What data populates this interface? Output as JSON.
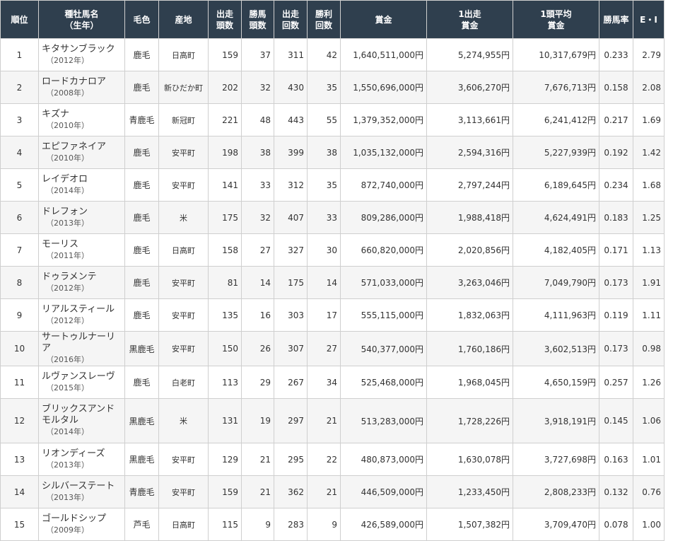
{
  "headers": {
    "rank": "順位",
    "name": "種牡馬名\n（生年）",
    "color": "毛色",
    "origin": "産地",
    "starters": "出走\n頭数",
    "winners": "勝馬\n頭数",
    "starts": "出走\n回数",
    "wins": "勝利\n回数",
    "earnings": "賞金",
    "per_start": "1出走\n賞金",
    "per_head": "1頭平均\n賞金",
    "win_rate": "勝馬率",
    "ei": "E・I"
  },
  "rows": [
    {
      "rank": "1",
      "name": "キタサンブラック",
      "year": "（2012年）",
      "color": "鹿毛",
      "origin": "日高町",
      "starters": "159",
      "winners": "37",
      "starts": "311",
      "wins": "42",
      "earnings": "1,640,511,000円",
      "per_start": "5,274,955円",
      "per_head": "10,317,679円",
      "win_rate": "0.233",
      "ei": "2.79"
    },
    {
      "rank": "2",
      "name": "ロードカナロア",
      "year": "（2008年）",
      "color": "鹿毛",
      "origin": "新ひだか町",
      "starters": "202",
      "winners": "32",
      "starts": "430",
      "wins": "35",
      "earnings": "1,550,696,000円",
      "per_start": "3,606,270円",
      "per_head": "7,676,713円",
      "win_rate": "0.158",
      "ei": "2.08"
    },
    {
      "rank": "3",
      "name": "キズナ",
      "year": "（2010年）",
      "color": "青鹿毛",
      "origin": "新冠町",
      "starters": "221",
      "winners": "48",
      "starts": "443",
      "wins": "55",
      "earnings": "1,379,352,000円",
      "per_start": "3,113,661円",
      "per_head": "6,241,412円",
      "win_rate": "0.217",
      "ei": "1.69"
    },
    {
      "rank": "4",
      "name": "エピファネイア",
      "year": "（2010年）",
      "color": "鹿毛",
      "origin": "安平町",
      "starters": "198",
      "winners": "38",
      "starts": "399",
      "wins": "38",
      "earnings": "1,035,132,000円",
      "per_start": "2,594,316円",
      "per_head": "5,227,939円",
      "win_rate": "0.192",
      "ei": "1.42"
    },
    {
      "rank": "5",
      "name": "レイデオロ",
      "year": "（2014年）",
      "color": "鹿毛",
      "origin": "安平町",
      "starters": "141",
      "winners": "33",
      "starts": "312",
      "wins": "35",
      "earnings": "872,740,000円",
      "per_start": "2,797,244円",
      "per_head": "6,189,645円",
      "win_rate": "0.234",
      "ei": "1.68"
    },
    {
      "rank": "6",
      "name": "ドレフォン",
      "year": "（2013年）",
      "color": "鹿毛",
      "origin": "米",
      "starters": "175",
      "winners": "32",
      "starts": "407",
      "wins": "33",
      "earnings": "809,286,000円",
      "per_start": "1,988,418円",
      "per_head": "4,624,491円",
      "win_rate": "0.183",
      "ei": "1.25"
    },
    {
      "rank": "7",
      "name": "モーリス",
      "year": "（2011年）",
      "color": "鹿毛",
      "origin": "日高町",
      "starters": "158",
      "winners": "27",
      "starts": "327",
      "wins": "30",
      "earnings": "660,820,000円",
      "per_start": "2,020,856円",
      "per_head": "4,182,405円",
      "win_rate": "0.171",
      "ei": "1.13"
    },
    {
      "rank": "8",
      "name": "ドゥラメンテ",
      "year": "（2012年）",
      "color": "鹿毛",
      "origin": "安平町",
      "starters": "81",
      "winners": "14",
      "starts": "175",
      "wins": "14",
      "earnings": "571,033,000円",
      "per_start": "3,263,046円",
      "per_head": "7,049,790円",
      "win_rate": "0.173",
      "ei": "1.91"
    },
    {
      "rank": "9",
      "name": "リアルスティール",
      "year": "（2012年）",
      "color": "鹿毛",
      "origin": "安平町",
      "starters": "135",
      "winners": "16",
      "starts": "303",
      "wins": "17",
      "earnings": "555,115,000円",
      "per_start": "1,832,063円",
      "per_head": "4,111,963円",
      "win_rate": "0.119",
      "ei": "1.11"
    },
    {
      "rank": "10",
      "name": "サートゥルナーリア",
      "year": "（2016年）",
      "color": "黒鹿毛",
      "origin": "安平町",
      "starters": "150",
      "winners": "26",
      "starts": "307",
      "wins": "27",
      "earnings": "540,377,000円",
      "per_start": "1,760,186円",
      "per_head": "3,602,513円",
      "win_rate": "0.173",
      "ei": "0.98"
    },
    {
      "rank": "11",
      "name": "ルヴァンスレーヴ",
      "year": "（2015年）",
      "color": "鹿毛",
      "origin": "白老町",
      "starters": "113",
      "winners": "29",
      "starts": "267",
      "wins": "34",
      "earnings": "525,468,000円",
      "per_start": "1,968,045円",
      "per_head": "4,650,159円",
      "win_rate": "0.257",
      "ei": "1.26"
    },
    {
      "rank": "12",
      "name": "ブリックスアンドモルタル",
      "year": "（2014年）",
      "color": "黒鹿毛",
      "origin": "米",
      "starters": "131",
      "winners": "19",
      "starts": "297",
      "wins": "21",
      "earnings": "513,283,000円",
      "per_start": "1,728,226円",
      "per_head": "3,918,191円",
      "win_rate": "0.145",
      "ei": "1.06"
    },
    {
      "rank": "13",
      "name": "リオンディーズ",
      "year": "（2013年）",
      "color": "黒鹿毛",
      "origin": "安平町",
      "starters": "129",
      "winners": "21",
      "starts": "295",
      "wins": "22",
      "earnings": "480,873,000円",
      "per_start": "1,630,078円",
      "per_head": "3,727,698円",
      "win_rate": "0.163",
      "ei": "1.01"
    },
    {
      "rank": "14",
      "name": "シルバーステート",
      "year": "（2013年）",
      "color": "青鹿毛",
      "origin": "安平町",
      "starters": "159",
      "winners": "21",
      "starts": "362",
      "wins": "21",
      "earnings": "446,509,000円",
      "per_start": "1,233,450円",
      "per_head": "2,808,233円",
      "win_rate": "0.132",
      "ei": "0.76"
    },
    {
      "rank": "15",
      "name": "ゴールドシップ",
      "year": "（2009年）",
      "color": "芦毛",
      "origin": "日高町",
      "starters": "115",
      "winners": "9",
      "starts": "283",
      "wins": "9",
      "earnings": "426,589,000円",
      "per_start": "1,507,382円",
      "per_head": "3,709,470円",
      "win_rate": "0.078",
      "ei": "1.00"
    }
  ]
}
